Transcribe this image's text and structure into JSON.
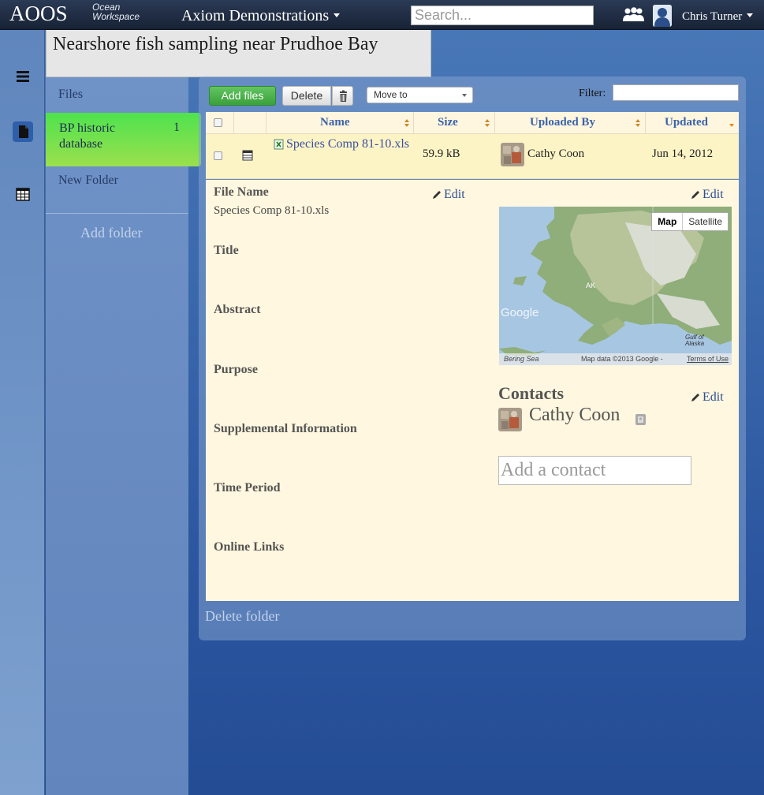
{
  "navbar": {
    "brand": "AOOS",
    "brand_sub_1": "Ocean",
    "brand_sub_2": "Workspace",
    "project": "Axiom Demonstrations",
    "search_placeholder": "Search...",
    "user": "Chris Turner"
  },
  "page_title": "Nearshore fish sampling near Prudhoe Bay",
  "sidebar": {
    "files_label": "Files",
    "folders": [
      {
        "label": "BP historic database",
        "count": "1",
        "active": true
      },
      {
        "label": "New Folder",
        "count": "",
        "active": false
      }
    ],
    "add_folder": "Add folder"
  },
  "toolbar": {
    "add_files": "Add files",
    "delete": "Delete",
    "move_to": "Move to",
    "filter_label": "Filter:"
  },
  "table": {
    "headers": [
      "Name",
      "Size",
      "Uploaded By",
      "Updated"
    ],
    "rows": [
      {
        "name": "Species Comp 81-10.xls",
        "size": "59.9 kB",
        "uploaded_by": "Cathy Coon",
        "updated": "Jun 14, 2012"
      }
    ]
  },
  "detail": {
    "file_name_label": "File Name",
    "file_name_value": "Species Comp 81-10.xls",
    "edit": "Edit",
    "fields": [
      "Title",
      "Abstract",
      "Purpose",
      "Supplemental Information",
      "Time Period",
      "Online Links"
    ],
    "map": {
      "map_btn": "Map",
      "satellite_btn": "Satellite",
      "google": "Google",
      "label_ak": "AK",
      "label_gulf": "Gulf of\nAlaska",
      "label_bering": "Bering Sea",
      "attribution": "Map data ©2013 Google -",
      "terms": "Terms of Use"
    },
    "contacts_title": "Contacts",
    "contact_name": "Cathy Coon",
    "add_contact_placeholder": "Add a contact"
  },
  "delete_folder": "Delete folder"
}
